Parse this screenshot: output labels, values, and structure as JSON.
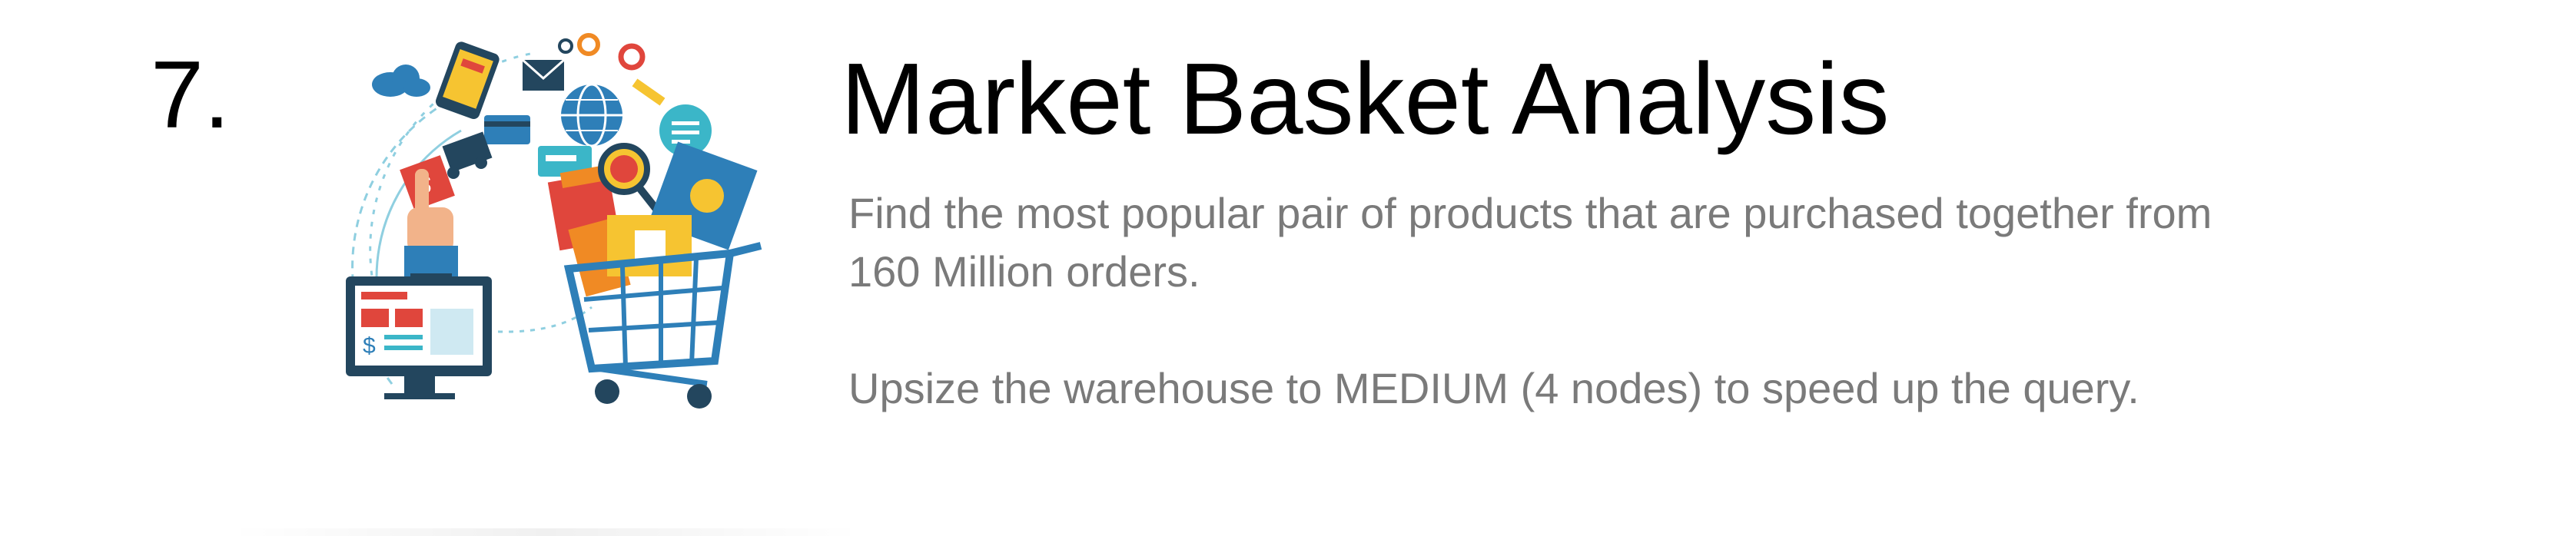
{
  "step": {
    "number": "7."
  },
  "slide": {
    "title": "Market Basket Analysis",
    "paragraphs": [
      "Find the most popular pair of products that are purchased together from",
      "160 Million orders.",
      "Upsize the warehouse to MEDIUM (4 nodes) to speed up the query."
    ]
  },
  "illustration": {
    "icons": [
      "cloud-icon",
      "phone-icon",
      "mail-icon",
      "gear-icon",
      "globe-icon",
      "chat-icon",
      "tag-icon",
      "truck-icon",
      "credit-card-icon",
      "pointing-hand-icon",
      "monitor-icon",
      "shopping-cart-icon",
      "shopping-bag-icon",
      "magnifier-icon",
      "pencil-icon"
    ],
    "colors": {
      "blue": "#2e7fb8",
      "teal": "#3bb6c8",
      "orange": "#f08a24",
      "yellow": "#f6c431",
      "red": "#e0463c",
      "dark": "#23465e"
    }
  }
}
